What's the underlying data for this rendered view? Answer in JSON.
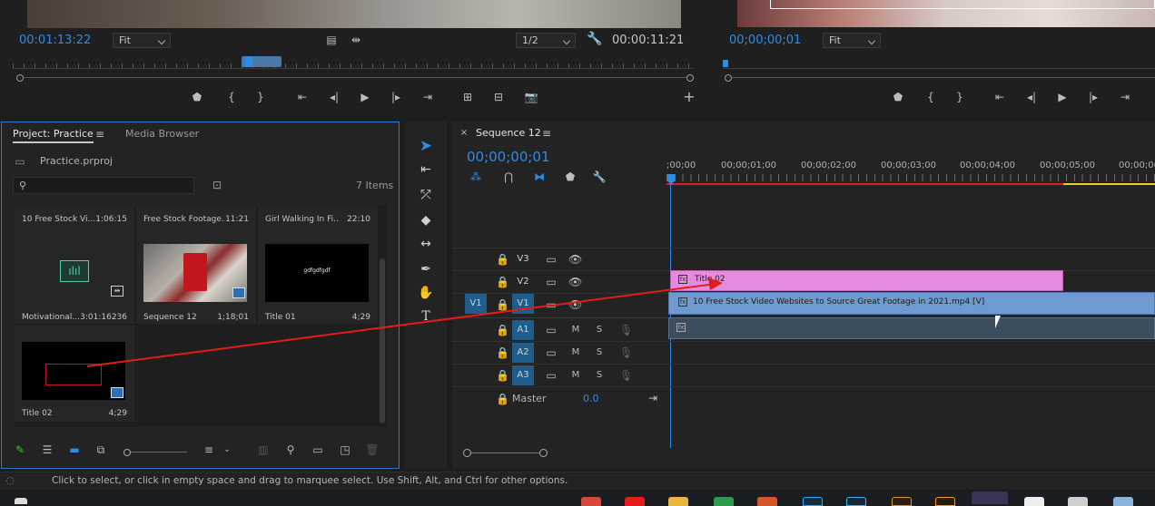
{
  "source_monitor": {
    "timecode": "00:01:13:22",
    "zoom": "Fit",
    "resolution": "1/2",
    "duration": "00:00:11:21"
  },
  "program_monitor": {
    "timecode": "00;00;00;01",
    "zoom": "Fit"
  },
  "project": {
    "tab_active": "Project: Practice",
    "tab_other": "Media Browser",
    "file_name": "Practice.prproj",
    "item_count": "7 Items",
    "search_placeholder": "",
    "items": [
      {
        "top_name": "10 Free Stock Vi...",
        "top_duration": "1:06:15",
        "name": "Motivational...",
        "duration": "3:01:16236"
      },
      {
        "top_name": "Free Stock Footage...",
        "top_duration": "11:21",
        "name": "Sequence 12",
        "duration": "1;18;01"
      },
      {
        "top_name": "Girl Walking In Fi...",
        "top_duration": "22:10",
        "name": "Title 01",
        "duration": "4;29",
        "thumb_text": "gdfgdfgdf"
      },
      {
        "name": "Title 02",
        "duration": "4;29"
      }
    ]
  },
  "sequence": {
    "tab": "Sequence 12",
    "timecode": "00;00;00;01",
    "ruler": [
      ";00;00",
      "00;00;01;00",
      "00;00;02;00",
      "00;00;03;00",
      "00;00;04;00",
      "00;00;05;00",
      "00;00;0("
    ],
    "tracks_video": [
      {
        "source": "",
        "label": "V3"
      },
      {
        "source": "",
        "label": "V2"
      },
      {
        "source": "V1",
        "label": "V1"
      }
    ],
    "tracks_audio": [
      {
        "label": "A1",
        "m": "M",
        "s": "S"
      },
      {
        "label": "A2",
        "m": "M",
        "s": "S"
      },
      {
        "label": "A3",
        "m": "M",
        "s": "S"
      }
    ],
    "master_label": "Master",
    "master_value": "0.0",
    "clip_title": "Title 02",
    "clip_video": "10 Free Stock Video Websites to Source Great Footage in 2021.mp4 [V]"
  },
  "status_bar": {
    "text": "Click to select, or click in empty space and drag to marquee select. Use Shift, Alt, and Ctrl for other options."
  },
  "colors": {
    "accent_blue": "#2d8ceb",
    "title_clip": "#e48be0",
    "video_clip": "#6e9ad0",
    "in_out_red": "#e02020",
    "drag_arrow": "#e21b1b"
  }
}
